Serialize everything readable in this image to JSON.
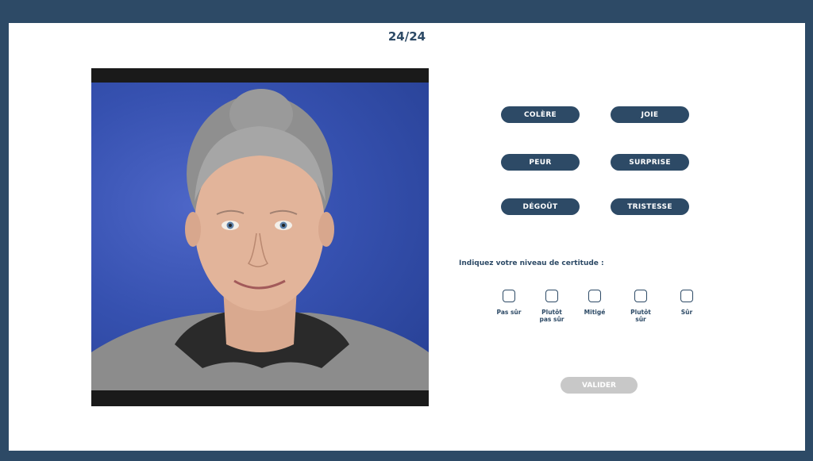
{
  "progress": {
    "label": "24/24"
  },
  "stimulus": {
    "description_icon": "face-video-icon"
  },
  "emotions": [
    {
      "label": "COLÈRE"
    },
    {
      "label": "JOIE"
    },
    {
      "label": "PEUR"
    },
    {
      "label": "SURPRISE"
    },
    {
      "label": "DÉGOÛT"
    },
    {
      "label": "TRISTESSE"
    }
  ],
  "certainty": {
    "question": "Indiquez votre niveau de certitude :",
    "options": [
      {
        "line1": "Pas sûr",
        "line2": ""
      },
      {
        "line1": "Plutôt",
        "line2": "pas sûr"
      },
      {
        "line1": "Mitigé",
        "line2": ""
      },
      {
        "line1": "Plutôt",
        "line2": "sûr"
      },
      {
        "line1": "Sûr",
        "line2": ""
      }
    ]
  },
  "validate": {
    "label": "VALIDER"
  },
  "colors": {
    "frame": "#2d4a66",
    "button": "#2d4a66",
    "disabled": "#c8c8c8",
    "backdrop": "#3651b0"
  }
}
